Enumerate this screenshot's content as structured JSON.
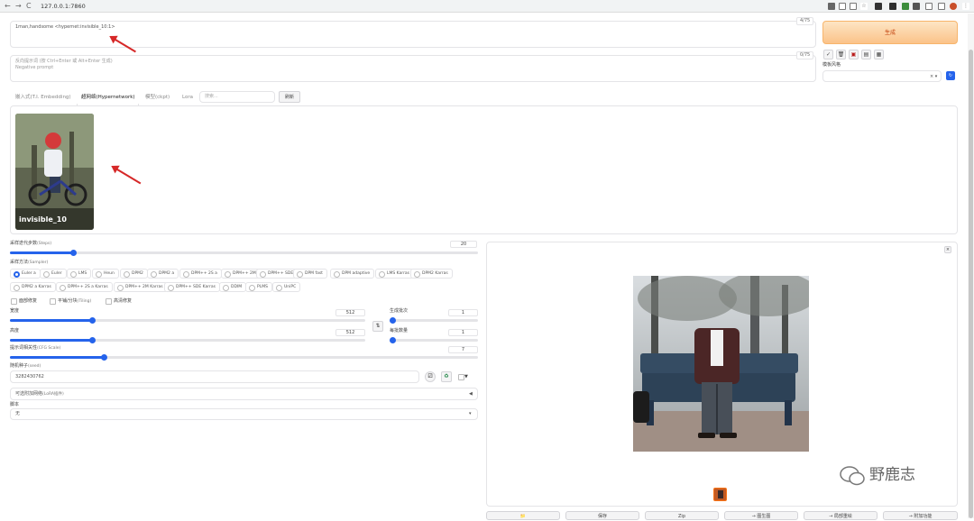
{
  "browser": {
    "url": "127.0.0.1:7860",
    "nav_back": "←",
    "nav_forward": "→",
    "nav_reload": "C"
  },
  "prompt": {
    "text": "1man,handsome <hypernet:invisible_10:1>",
    "counter": "4/75"
  },
  "negative_prompt": {
    "placeholder_line1": "反向提示词 (按 Ctrl+Enter 或 Alt+Enter 生成)",
    "placeholder_line2": "Negative prompt",
    "counter": "0/75"
  },
  "generate_label": "生成",
  "tool_icons": [
    "✓",
    "🗑",
    "▣",
    "▤",
    "▦"
  ],
  "style_label": "模板风格",
  "style_clear": "× ▾",
  "network_tabs": {
    "tabs": [
      "嵌入式(T.I. Embedding)",
      "超网络(Hypernetwork)",
      "模型(ckpt)",
      "Lora"
    ],
    "active_index": 1,
    "search_placeholder": "搜索...",
    "refresh_label": "刷新"
  },
  "hypernet_card": {
    "name": "invisible_10"
  },
  "steps": {
    "label": "采样迭代步数",
    "label_en": "(Steps)",
    "value": "20",
    "fraction": 0.135
  },
  "sampler": {
    "label": "采样方法",
    "label_en": "(Sampler)",
    "row1": [
      "Euler a",
      "Euler",
      "LMS",
      "Heun",
      "DPM2",
      "DPM2 a",
      "DPM++ 2S a",
      "DPM++ 2M",
      "DPM++ SDE",
      "DPM fast",
      "DPM adaptive",
      "LMS Karras",
      "DPM2 Karras"
    ],
    "row2": [
      "DPM2 a Karras",
      "DPM++ 2S a Karras",
      "DPM++ 2M Karras",
      "DPM++ SDE Karras",
      "DDIM",
      "PLMS",
      "UniPC"
    ],
    "selected": "Euler a"
  },
  "options": {
    "restore_faces": "面部修复",
    "tiling": "平铺/分块",
    "tiling_en": "(Tiling)",
    "hires_fix": "高清修复"
  },
  "width": {
    "label": "宽度",
    "value": "512",
    "fraction": 0.23
  },
  "height": {
    "label": "高度",
    "value": "512",
    "fraction": 0.23
  },
  "swap_icon": "⇅",
  "batch_count": {
    "label": "生成批次",
    "value": "1",
    "fraction": 0.0
  },
  "batch_size": {
    "label": "每批数量",
    "value": "1",
    "fraction": 0.0
  },
  "cfg": {
    "label": "提示词相关性",
    "label_en": "(CFG Scale)",
    "value": "7",
    "fraction": 0.2
  },
  "seed": {
    "label": "随机种子",
    "label_en": "(seed)",
    "value": "3282430762",
    "dice_icon": "⚂",
    "recycle_icon": "♻",
    "extra_icon": "▼"
  },
  "lora_extension": {
    "label": "可选附加网络",
    "label_en": "(LoRA插件)",
    "toggle_icon": "◀"
  },
  "script": {
    "label": "脚本",
    "value": "无",
    "chevron": "▾"
  },
  "output": {
    "close_icon": "×"
  },
  "action_buttons": [
    "📁",
    "保存",
    "Zip",
    "→ 图生图",
    "→ 局部重绘",
    "→ 附加功能"
  ],
  "watermark": "野鹿志",
  "colors": {
    "accent": "#2563eb",
    "generate": "#fbc389",
    "arrow": "#d62828"
  }
}
